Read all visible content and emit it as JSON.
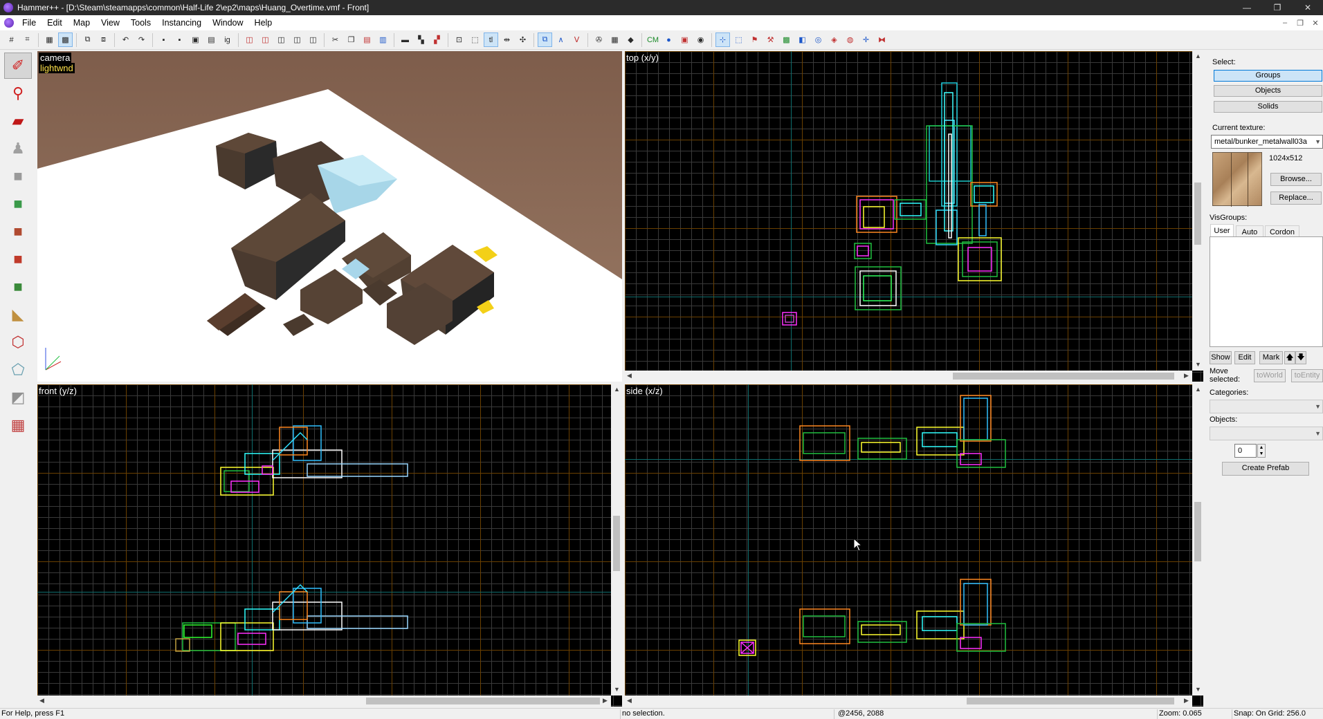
{
  "window": {
    "title": "Hammer++ - [D:\\Steam\\steamapps\\common\\Half-Life 2\\ep2\\maps\\Huang_Overtime.vmf - Front]",
    "controls": [
      "—",
      "❐",
      "✕"
    ]
  },
  "menu": [
    "File",
    "Edit",
    "Map",
    "View",
    "Tools",
    "Instancing",
    "Window",
    "Help"
  ],
  "mdi_controls": [
    "–",
    "❐",
    "✕"
  ],
  "toolbar": {
    "icons": [
      {
        "name": "grid-toggle-icon",
        "glyph": "#"
      },
      {
        "name": "grid-3d-icon",
        "glyph": "⌗"
      },
      {
        "name": "grid-smaller-icon",
        "glyph": "▦"
      },
      {
        "name": "grid-larger-icon",
        "glyph": "▩"
      },
      {
        "name": "carve-icon",
        "glyph": "⧉"
      },
      {
        "name": "group-icon",
        "glyph": "⧈"
      },
      {
        "name": "undo-icon",
        "glyph": "↶"
      },
      {
        "name": "redo-icon",
        "glyph": "↷"
      },
      {
        "name": "save-icon",
        "glyph": "▪"
      },
      {
        "name": "print-icon",
        "glyph": "▪"
      },
      {
        "name": "hide-icon",
        "glyph": "▣"
      },
      {
        "name": "unhide-icon",
        "glyph": "▤"
      },
      {
        "name": "ig-icon",
        "glyph": "ig"
      },
      {
        "name": "cube-red-1-icon",
        "glyph": "◫"
      },
      {
        "name": "cube-red-2-icon",
        "glyph": "◫"
      },
      {
        "name": "cube-grey-1-icon",
        "glyph": "◫"
      },
      {
        "name": "cube-grey-2-icon",
        "glyph": "◫"
      },
      {
        "name": "cube-grey-3-icon",
        "glyph": "◫"
      },
      {
        "name": "cut-icon",
        "glyph": "✂"
      },
      {
        "name": "copy-icon",
        "glyph": "❐"
      },
      {
        "name": "paste-icon",
        "glyph": "▤"
      },
      {
        "name": "paste-special-icon",
        "glyph": "▥"
      },
      {
        "name": "texture-bar-icon",
        "glyph": "▬"
      },
      {
        "name": "texture-lock-icon",
        "glyph": "▚"
      },
      {
        "name": "texture-scale-icon",
        "glyph": "▞"
      },
      {
        "name": "cordon-icon",
        "glyph": "⊡"
      },
      {
        "name": "select-icon",
        "glyph": "⬚"
      },
      {
        "name": "tl-icon",
        "glyph": "tl"
      },
      {
        "name": "arrows-icon",
        "glyph": "⇹"
      },
      {
        "name": "sprinkle-icon",
        "glyph": "✣"
      },
      {
        "name": "helpers-icon",
        "glyph": "⧉"
      },
      {
        "name": "models-icon",
        "glyph": "∧"
      },
      {
        "name": "fade-icon",
        "glyph": "Ⅴ"
      },
      {
        "name": "compass-icon",
        "glyph": "✇"
      },
      {
        "name": "grid-blue-icon",
        "glyph": "▦"
      },
      {
        "name": "entity-icon",
        "glyph": "◆"
      },
      {
        "name": "cm-icon",
        "glyph": "CM"
      },
      {
        "name": "run-map-icon",
        "glyph": "●"
      },
      {
        "name": "draw-icon",
        "glyph": "▣"
      },
      {
        "name": "gold-ring-icon",
        "glyph": "◉"
      },
      {
        "name": "tool-a-icon",
        "glyph": "⊹"
      },
      {
        "name": "tool-b-icon",
        "glyph": "⬚"
      },
      {
        "name": "tool-c-icon",
        "glyph": "⚑"
      },
      {
        "name": "tool-d-icon",
        "glyph": "⚒"
      },
      {
        "name": "tool-e-icon",
        "glyph": "▩"
      },
      {
        "name": "tool-f-icon",
        "glyph": "◧"
      },
      {
        "name": "tool-g-icon",
        "glyph": "◎"
      },
      {
        "name": "tool-h-icon",
        "glyph": "◈"
      },
      {
        "name": "tool-i-icon",
        "glyph": "◍"
      },
      {
        "name": "tool-j-icon",
        "glyph": "✛"
      },
      {
        "name": "tool-k-icon",
        "glyph": "⧓"
      }
    ]
  },
  "tools": [
    {
      "name": "selection-tool-icon",
      "glyph": "✐",
      "color": "#d02020"
    },
    {
      "name": "magnify-tool-icon",
      "glyph": "⚲",
      "color": "#d02020"
    },
    {
      "name": "camera-tool-icon",
      "glyph": "▰",
      "color": "#c01818"
    },
    {
      "name": "entity-tool-icon",
      "glyph": "♟",
      "color": "#a0a0a0"
    },
    {
      "name": "block-tool-icon",
      "glyph": "■",
      "color": "#9a9a9a"
    },
    {
      "name": "texture-application-icon",
      "glyph": "■",
      "color": "#3a9a4a"
    },
    {
      "name": "apply-texture-icon",
      "glyph": "■",
      "color": "#b04a30"
    },
    {
      "name": "decal-tool-icon",
      "glyph": "■",
      "color": "#c03a2a"
    },
    {
      "name": "overlay-tool-icon",
      "glyph": "■",
      "color": "#3a8a3a"
    },
    {
      "name": "clipping-tool-icon",
      "glyph": "◣",
      "color": "#c09040"
    },
    {
      "name": "vertex-tool-icon",
      "glyph": "⬡",
      "color": "#c03030"
    },
    {
      "name": "path-tool-icon",
      "glyph": "⬠",
      "color": "#6aa0b0"
    },
    {
      "name": "sculpt-tool-icon",
      "glyph": "◩",
      "color": "#909090"
    },
    {
      "name": "paint-tool-icon",
      "glyph": "▦",
      "color": "#c04040"
    }
  ],
  "viewports": {
    "camera": {
      "label": "camera",
      "sublabel": "lightwnd"
    },
    "top": {
      "label": "top (x/y)"
    },
    "front": {
      "label": "front (y/z)"
    },
    "side": {
      "label": "side (x/z)"
    }
  },
  "panel": {
    "select_label": "Select:",
    "select_buttons": [
      "Groups",
      "Objects",
      "Solids"
    ],
    "selected_button": "Groups",
    "current_texture_label": "Current texture:",
    "current_texture": "metal/bunker_metalwall03a",
    "texture_size": "1024x512",
    "browse_label": "Browse...",
    "replace_label": "Replace...",
    "visgroups_label": "VisGroups:",
    "visgroup_tabs": [
      "User",
      "Auto",
      "Cordon"
    ],
    "show_label": "Show",
    "edit_label": "Edit",
    "mark_label": "Mark",
    "up_label": "🡅",
    "down_label": "🡇",
    "move_selected_label": "Move selected:",
    "to_world_label": "toWorld",
    "to_entity_label": "toEntity",
    "categories_label": "Categories:",
    "objects_label": "Objects:",
    "count_value": "0",
    "create_prefab_label": "Create Prefab"
  },
  "status": {
    "help": "For Help, press F1",
    "selection": "no selection.",
    "coords": "@2456, 2088",
    "zoom": "Zoom: 0.065",
    "snap": "Snap: On Grid: 256.0"
  }
}
